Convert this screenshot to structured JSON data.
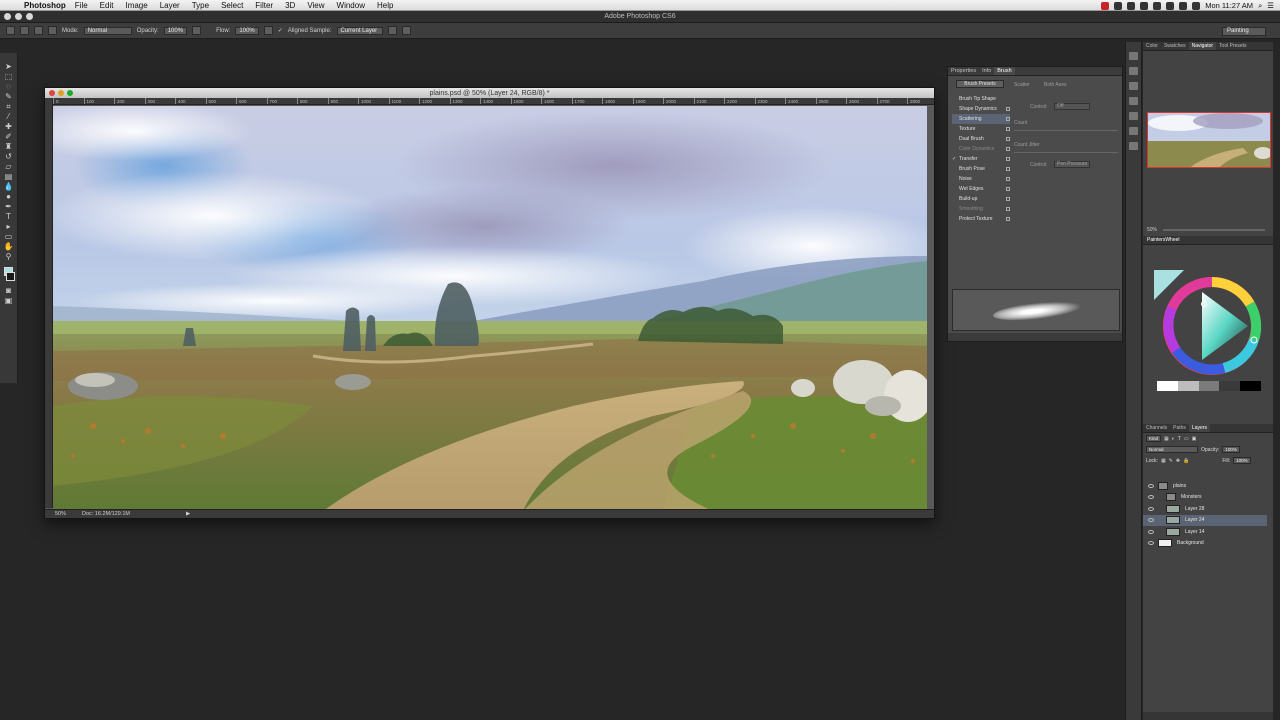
{
  "menubar": {
    "app_name": "Photoshop",
    "items": [
      "File",
      "Edit",
      "Image",
      "Layer",
      "Type",
      "Select",
      "Filter",
      "3D",
      "View",
      "Window",
      "Help"
    ],
    "clock": "Mon 11:27 AM"
  },
  "app_title": "Adobe Photoshop CS6",
  "options": {
    "mode_label": "Mode:",
    "mode_value": "Normal",
    "opacity_label": "Opacity:",
    "opacity_value": "100%",
    "flow_label": "Flow:",
    "flow_value": "100%",
    "aligned_label": "Aligned Sample:",
    "sample_value": "Current Layer",
    "workspace": "Painting"
  },
  "document": {
    "title": "plains.psd @ 50% (Layer 24, RGB/8) *",
    "ruler_ticks": [
      "0",
      "100",
      "200",
      "300",
      "400",
      "500",
      "600",
      "700",
      "800",
      "900",
      "1000",
      "1100",
      "1200",
      "1300",
      "1400",
      "1500",
      "1600",
      "1700",
      "1800",
      "1900",
      "2000",
      "2100",
      "2200",
      "2300",
      "2400",
      "2500",
      "2600",
      "2700",
      "2800",
      "2900",
      "3000",
      "3100",
      "3200",
      "3300",
      "3400",
      "3500"
    ],
    "zoom": "50%",
    "doc_size": "Doc: 16.2M/129.1M"
  },
  "brush_panel": {
    "tabs": [
      "Properties",
      "Info",
      "Brush"
    ],
    "presets_button": "Brush Presets",
    "items": [
      {
        "label": "Brush Tip Shape",
        "checked": false,
        "selected": false,
        "dim": false,
        "lock": false
      },
      {
        "label": "Shape Dynamics",
        "checked": false,
        "selected": false,
        "dim": false,
        "lock": true
      },
      {
        "label": "Scattering",
        "checked": false,
        "selected": true,
        "dim": false,
        "lock": true
      },
      {
        "label": "Texture",
        "checked": false,
        "selected": false,
        "dim": false,
        "lock": true
      },
      {
        "label": "Dual Brush",
        "checked": false,
        "selected": false,
        "dim": false,
        "lock": true
      },
      {
        "label": "Color Dynamics",
        "checked": false,
        "selected": false,
        "dim": true,
        "lock": true
      },
      {
        "label": "Transfer",
        "checked": true,
        "selected": false,
        "dim": false,
        "lock": true
      },
      {
        "label": "Brush Pose",
        "checked": false,
        "selected": false,
        "dim": false,
        "lock": true
      },
      {
        "label": "Noise",
        "checked": false,
        "selected": false,
        "dim": false,
        "lock": true
      },
      {
        "label": "Wet Edges",
        "checked": false,
        "selected": false,
        "dim": false,
        "lock": true
      },
      {
        "label": "Build-up",
        "checked": false,
        "selected": false,
        "dim": false,
        "lock": true
      },
      {
        "label": "Smoothing",
        "checked": false,
        "selected": false,
        "dim": true,
        "lock": true
      },
      {
        "label": "Protect Texture",
        "checked": false,
        "selected": false,
        "dim": false,
        "lock": true
      }
    ],
    "scatter_label": "Scatter",
    "both_axes_label": "Both Axes",
    "control_label": "Control:",
    "control_value": "Off",
    "count_label": "Count",
    "count_jitter_label": "Count Jitter",
    "control2_value": "Pen Pressure"
  },
  "navigator": {
    "tabs": [
      "Color",
      "Swatches",
      "Navigator",
      "Tool Presets"
    ],
    "zoom": "50%"
  },
  "painters_wheel": {
    "title": "PaintersWheel"
  },
  "layers_panel": {
    "tabs": [
      "Channels",
      "Paths",
      "Layers"
    ],
    "kind_label": "Kind",
    "blend_mode": "Normal",
    "opacity_label": "Opacity:",
    "opacity_value": "100%",
    "lock_label": "Lock:",
    "fill_label": "Fill:",
    "fill_value": "100%",
    "layers": [
      {
        "name": "plains",
        "type": "group",
        "indent": 0,
        "selected": false
      },
      {
        "name": "Monsters",
        "type": "group",
        "indent": 1,
        "selected": false
      },
      {
        "name": "Layer 28",
        "type": "layer",
        "indent": 1,
        "selected": false
      },
      {
        "name": "Layer 24",
        "type": "layer",
        "indent": 1,
        "selected": true
      },
      {
        "name": "Layer 14",
        "type": "layer",
        "indent": 1,
        "selected": false
      },
      {
        "name": "Background",
        "type": "layer",
        "indent": 0,
        "selected": false
      }
    ]
  },
  "colors": {
    "selection": "#5a6474",
    "foreground_swatch": "#a9e0e0",
    "navigator_frame": "#e0342f"
  }
}
